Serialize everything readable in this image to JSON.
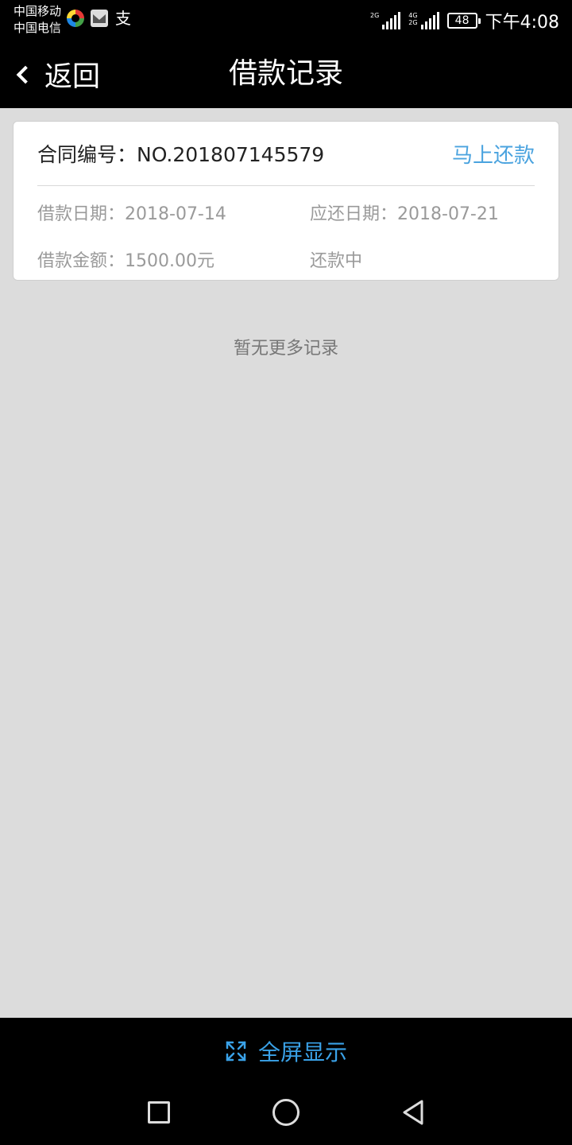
{
  "status_bar": {
    "carrier_1": "中国移动",
    "carrier_2": "中国电信",
    "sim1_network": "2G",
    "sim2_network_top": "4G",
    "sim2_network_bottom": "2G",
    "battery": "48",
    "time": "下午4:08",
    "icons": [
      "color-ring-app-icon",
      "mail-app-icon",
      "alipay-icon"
    ]
  },
  "header": {
    "back_label": "返回",
    "title": "借款记录"
  },
  "record": {
    "contract_label": "合同编号：",
    "contract_number": "NO.201807145579",
    "repay_label": "马上还款",
    "loan_date_label": "借款日期：",
    "loan_date": "2018-07-14",
    "due_date_label": "应还日期：",
    "due_date": "2018-07-21",
    "amount_label": "借款金额：",
    "amount": "1500.00元",
    "status": "还款中"
  },
  "empty_message": "暂无更多记录",
  "bottom": {
    "fullscreen_label": "全屏显示"
  },
  "colors": {
    "accent": "#4aa3df",
    "fullscreen_blue": "#3aa2e8",
    "background": "#dcdcdc",
    "header_bg": "#000000"
  }
}
